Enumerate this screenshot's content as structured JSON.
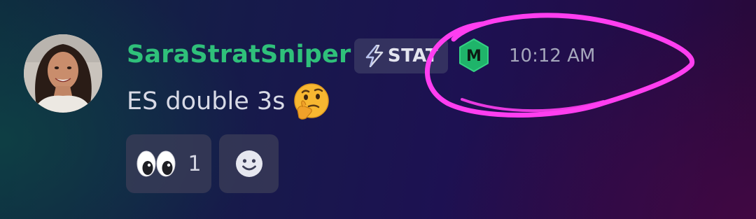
{
  "message": {
    "author": {
      "username": "SaraStratSniper",
      "username_color": "#2fc07a",
      "avatar_icon": "profile-photo"
    },
    "role_tag": {
      "icon": "lightning-bolt-icon",
      "label": "STAT"
    },
    "moderator_badge": {
      "letter": "M",
      "color": "#1fb46a"
    },
    "timestamp": "10:12 AM",
    "body_text": "ES double 3s",
    "body_emoji": "thinking-face-icon",
    "reactions": [
      {
        "emoji": "eyes-icon",
        "count": "1"
      }
    ],
    "add_reaction_icon": "smiley-icon"
  },
  "annotation": {
    "shape": "hand-drawn-circle",
    "color": "#ff3ef0"
  }
}
